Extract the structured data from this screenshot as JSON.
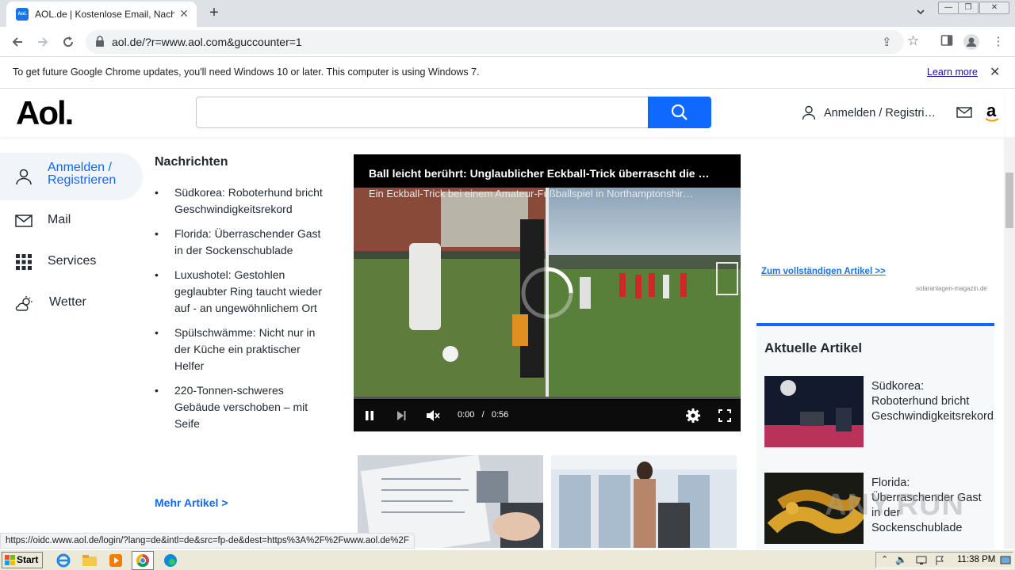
{
  "browser": {
    "tab_title": "AOL.de | Kostenlose Email, Nachrichten",
    "favicon_text": "Aol.",
    "url": "aol.de/?r=www.aol.com&guccounter=1",
    "infobar_message": "To get future Google Chrome updates, you'll need Windows 10 or later. This computer is using Windows 7.",
    "infobar_link": "Learn more",
    "status_url": "https://oidc.www.aol.de/login/?lang=de&intl=de&src=fp-de&dest=https%3A%2F%2Fwww.aol.de%2F"
  },
  "header": {
    "logo": "Aol.",
    "search_placeholder": "",
    "signin": "Anmelden / Registri…",
    "amazon": "a"
  },
  "leftnav": {
    "signin_line1": "Anmelden /",
    "signin_line2": "Registrieren",
    "mail": "Mail",
    "services": "Services",
    "weather": "Wetter"
  },
  "news": {
    "title": "Nachrichten",
    "items": [
      "Südkorea: Roboterhund bricht Geschwindigkeitsrekord",
      "Florida: Überraschender Gast in der Sockenschublade",
      "Luxushotel: Gestohlen geglaubter Ring taucht wieder auf - an ungewöhnlichem Ort",
      "Spülschwämme: Nicht nur in der Küche ein praktischer Helfer",
      "220-Tonnen-schweres Gebäude verschoben – mit Seife"
    ],
    "more": "Mehr Artikel >"
  },
  "video": {
    "title": "Ball leicht berührt: Unglaublicher Eckball-Trick überrascht die …",
    "caption": "Ein Eckball-Trick bei einem Amateur-Fußballspiel in Northamptonshir…",
    "time_current": "0:00",
    "time_separator": "/",
    "time_total": "0:56",
    "progress": 0
  },
  "right": {
    "ad_link": "Zum vollständigen Artikel >>",
    "ad_source": "solaranlagen-magazin.de",
    "section_title": "Aktuelle Artikel",
    "articles": [
      "Südkorea: Roboterhund bricht Geschwindigkeitsrekord",
      "Florida: Überraschender Gast in der Sockenschublade"
    ]
  },
  "watermark": "ANY.RUN",
  "taskbar": {
    "start": "Start",
    "clock": "11:38 PM"
  },
  "colors": {
    "accent": "#0f69ff",
    "link": "#1a73e8"
  }
}
